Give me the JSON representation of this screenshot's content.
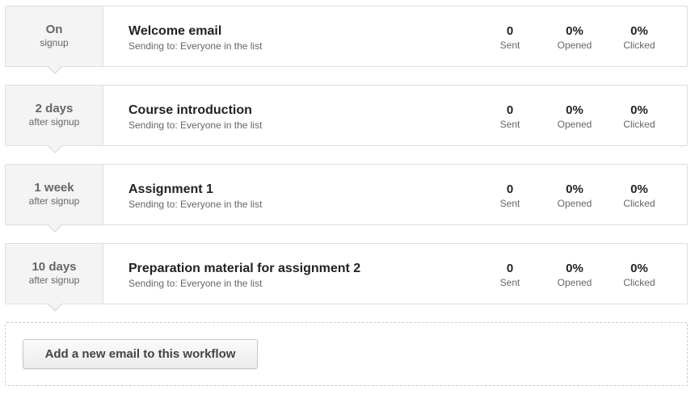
{
  "emails": [
    {
      "delay_amount": "On",
      "delay_unit": "signup",
      "title": "Welcome email",
      "sending_to": "Sending to: Everyone in the list",
      "sent_value": "0",
      "sent_label": "Sent",
      "opened_value": "0%",
      "opened_label": "Opened",
      "clicked_value": "0%",
      "clicked_label": "Clicked"
    },
    {
      "delay_amount": "2 days",
      "delay_unit": "after signup",
      "title": "Course introduction",
      "sending_to": "Sending to: Everyone in the list",
      "sent_value": "0",
      "sent_label": "Sent",
      "opened_value": "0%",
      "opened_label": "Opened",
      "clicked_value": "0%",
      "clicked_label": "Clicked"
    },
    {
      "delay_amount": "1 week",
      "delay_unit": "after signup",
      "title": "Assignment 1",
      "sending_to": "Sending to: Everyone in the list",
      "sent_value": "0",
      "sent_label": "Sent",
      "opened_value": "0%",
      "opened_label": "Opened",
      "clicked_value": "0%",
      "clicked_label": "Clicked"
    },
    {
      "delay_amount": "10 days",
      "delay_unit": "after signup",
      "title": "Preparation material for assignment 2",
      "sending_to": "Sending to: Everyone in the list",
      "sent_value": "0",
      "sent_label": "Sent",
      "opened_value": "0%",
      "opened_label": "Opened",
      "clicked_value": "0%",
      "clicked_label": "Clicked"
    }
  ],
  "add_button_label": "Add a new email to this workflow",
  "colors": {
    "card_border": "#dedede",
    "delay_background": "#f4f4f4",
    "title_text": "#222222",
    "secondary_text": "#666666"
  }
}
